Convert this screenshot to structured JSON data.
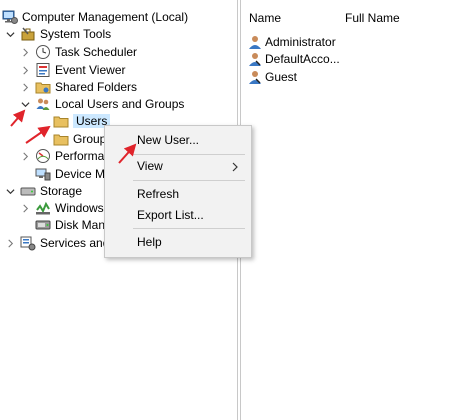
{
  "tree": {
    "root": {
      "label": "Computer Management (Local)",
      "icon": "computer-management-icon"
    },
    "items": [
      {
        "label": "System Tools",
        "icon": "toolbox-icon",
        "expanded": true
      },
      {
        "label": "Task Scheduler",
        "icon": "clock-icon",
        "expanded": false
      },
      {
        "label": "Event Viewer",
        "icon": "event-viewer-icon",
        "expanded": false
      },
      {
        "label": "Shared Folders",
        "icon": "shared-folder-icon",
        "expanded": false
      },
      {
        "label": "Local Users and Groups",
        "icon": "users-groups-icon",
        "expanded": true
      },
      {
        "label": "Users",
        "icon": "folder-icon",
        "selected": true
      },
      {
        "label": "Group",
        "icon": "folder-icon"
      },
      {
        "label": "Performa",
        "icon": "performance-icon",
        "expanded": false
      },
      {
        "label": "Device M",
        "icon": "device-manager-icon"
      },
      {
        "label": "Storage",
        "icon": "storage-icon",
        "expanded": true
      },
      {
        "label": "Windows",
        "icon": "windows-backup-icon",
        "expanded": false
      },
      {
        "label": "Disk Man",
        "icon": "disk-management-icon"
      },
      {
        "label": "Services and",
        "icon": "services-icon",
        "expanded": false
      }
    ]
  },
  "list": {
    "columns": [
      "Name",
      "Full Name"
    ],
    "rows": [
      {
        "name": "Administrator",
        "full_name": "",
        "icon": "user-icon"
      },
      {
        "name": "DefaultAcco...",
        "full_name": "",
        "icon": "user-icon"
      },
      {
        "name": "Guest",
        "full_name": "",
        "icon": "user-icon"
      }
    ]
  },
  "context_menu": {
    "items": [
      "New User...",
      "View",
      "Refresh",
      "Export List...",
      "Help"
    ]
  },
  "colors": {
    "selection": "#cce8ff",
    "menu_background": "#f2f2f2",
    "annotation_arrow": "#e0242b",
    "folder": "#e8c060"
  }
}
